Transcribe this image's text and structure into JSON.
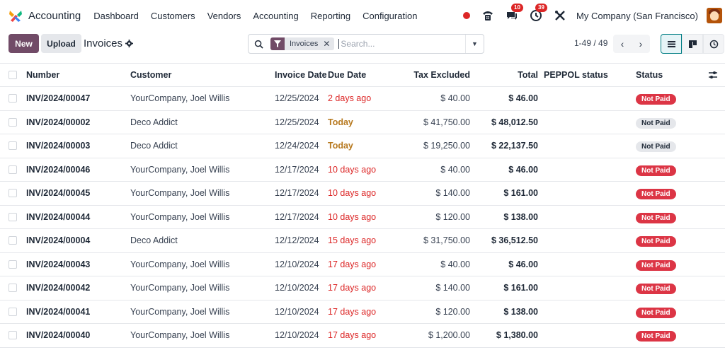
{
  "navbar": {
    "app_name": "Accounting",
    "menu": [
      "Dashboard",
      "Customers",
      "Vendors",
      "Accounting",
      "Reporting",
      "Configuration"
    ],
    "messages_count": "10",
    "activities_count": "39",
    "company": "My Company (San Francisco)"
  },
  "control": {
    "new_label": "New",
    "upload_label": "Upload",
    "title": "Invoices",
    "facet_label": "Invoices",
    "search_placeholder": "Search...",
    "pager": "1-49 / 49"
  },
  "table": {
    "columns": {
      "number": "Number",
      "customer": "Customer",
      "invoice_date": "Invoice Date",
      "due_date": "Due Date",
      "tax_excluded": "Tax Excluded",
      "total": "Total",
      "peppol": "PEPPOL status",
      "status": "Status"
    },
    "rows": [
      {
        "number": "INV/2024/00047",
        "customer": "YourCompany, Joel Willis",
        "invoice_date": "12/25/2024",
        "due": "2 days ago",
        "due_tone": "red",
        "tax_excluded": "$ 40.00",
        "total": "$ 46.00",
        "status": "Not Paid",
        "status_tone": "red"
      },
      {
        "number": "INV/2024/00002",
        "customer": "Deco Addict",
        "invoice_date": "12/25/2024",
        "due": "Today",
        "due_tone": "amber",
        "tax_excluded": "$ 41,750.00",
        "total": "$ 48,012.50",
        "status": "Not Paid",
        "status_tone": "grey"
      },
      {
        "number": "INV/2024/00003",
        "customer": "Deco Addict",
        "invoice_date": "12/24/2024",
        "due": "Today",
        "due_tone": "amber",
        "tax_excluded": "$ 19,250.00",
        "total": "$ 22,137.50",
        "status": "Not Paid",
        "status_tone": "grey"
      },
      {
        "number": "INV/2024/00046",
        "customer": "YourCompany, Joel Willis",
        "invoice_date": "12/17/2024",
        "due": "10 days ago",
        "due_tone": "red",
        "tax_excluded": "$ 40.00",
        "total": "$ 46.00",
        "status": "Not Paid",
        "status_tone": "red"
      },
      {
        "number": "INV/2024/00045",
        "customer": "YourCompany, Joel Willis",
        "invoice_date": "12/17/2024",
        "due": "10 days ago",
        "due_tone": "red",
        "tax_excluded": "$ 140.00",
        "total": "$ 161.00",
        "status": "Not Paid",
        "status_tone": "red"
      },
      {
        "number": "INV/2024/00044",
        "customer": "YourCompany, Joel Willis",
        "invoice_date": "12/17/2024",
        "due": "10 days ago",
        "due_tone": "red",
        "tax_excluded": "$ 120.00",
        "total": "$ 138.00",
        "status": "Not Paid",
        "status_tone": "red"
      },
      {
        "number": "INV/2024/00004",
        "customer": "Deco Addict",
        "invoice_date": "12/12/2024",
        "due": "15 days ago",
        "due_tone": "red",
        "tax_excluded": "$ 31,750.00",
        "total": "$ 36,512.50",
        "status": "Not Paid",
        "status_tone": "red"
      },
      {
        "number": "INV/2024/00043",
        "customer": "YourCompany, Joel Willis",
        "invoice_date": "12/10/2024",
        "due": "17 days ago",
        "due_tone": "red",
        "tax_excluded": "$ 40.00",
        "total": "$ 46.00",
        "status": "Not Paid",
        "status_tone": "red"
      },
      {
        "number": "INV/2024/00042",
        "customer": "YourCompany, Joel Willis",
        "invoice_date": "12/10/2024",
        "due": "17 days ago",
        "due_tone": "red",
        "tax_excluded": "$ 140.00",
        "total": "$ 161.00",
        "status": "Not Paid",
        "status_tone": "red"
      },
      {
        "number": "INV/2024/00041",
        "customer": "YourCompany, Joel Willis",
        "invoice_date": "12/10/2024",
        "due": "17 days ago",
        "due_tone": "red",
        "tax_excluded": "$ 120.00",
        "total": "$ 138.00",
        "status": "Not Paid",
        "status_tone": "red"
      },
      {
        "number": "INV/2024/00040",
        "customer": "YourCompany, Joel Willis",
        "invoice_date": "12/10/2024",
        "due": "17 days ago",
        "due_tone": "red",
        "tax_excluded": "$ 1,200.00",
        "total": "$ 1,380.00",
        "status": "Not Paid",
        "status_tone": "red"
      }
    ]
  },
  "colors": {
    "brand": "#714b67",
    "accent": "#017e84",
    "danger": "#dc3545",
    "warning": "#b7791f"
  }
}
